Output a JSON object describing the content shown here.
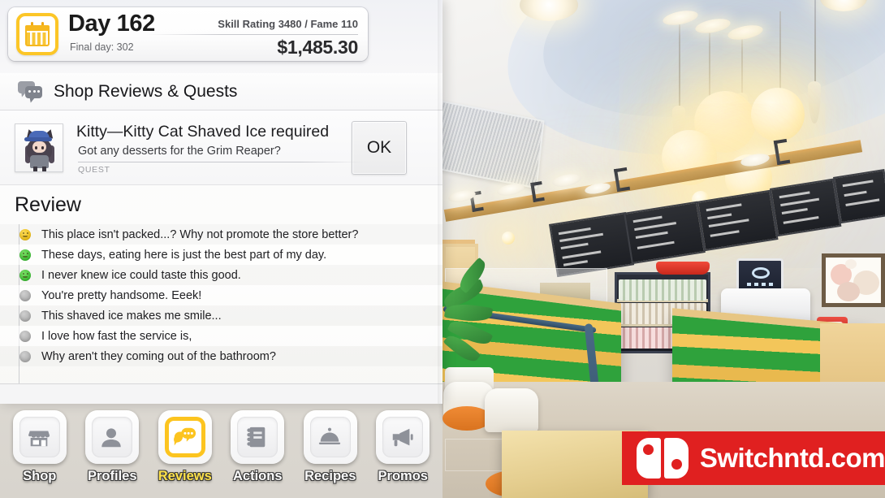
{
  "header": {
    "calendar_icon": "calendar-icon",
    "day_title": "Day 162",
    "final_day": "Final day: 302",
    "skill_line": "Skill Rating 3480 / Fame 110",
    "money": "$1,485.30",
    "accent_color": "#fcc627"
  },
  "section": {
    "icon": "speech-bubbles-icon",
    "title": "Shop Reviews & Quests"
  },
  "quest": {
    "avatar": "chibi-cat-girl-avatar",
    "title": "Kitty—Kitty Cat Shaved Ice required",
    "subtitle": "Got any desserts for the Grim Reaper?",
    "tag": "QUEST",
    "ok_label": "OK"
  },
  "review": {
    "heading": "Review",
    "items": [
      {
        "mood": "yellow",
        "text": "This place isn't packed...? Why not promote the store better?"
      },
      {
        "mood": "green",
        "text": "These days, eating here is just the best part of my day."
      },
      {
        "mood": "green",
        "text": "I never knew ice could taste this good."
      },
      {
        "mood": "gray",
        "text": "You're pretty handsome. Eeek!"
      },
      {
        "mood": "gray",
        "text": "This shaved ice makes me smile..."
      },
      {
        "mood": "gray",
        "text": "I love how fast the service is,"
      },
      {
        "mood": "gray",
        "text": "Why aren't they coming out of the bathroom?"
      }
    ],
    "mood_colors": {
      "yellow": "#efc018",
      "green": "#3cc033",
      "gray": "#aeaeae"
    }
  },
  "nav": {
    "items": [
      {
        "label": "Shop",
        "icon": "storefront-icon",
        "active": false
      },
      {
        "label": "Profiles",
        "icon": "person-icon",
        "active": false
      },
      {
        "label": "Reviews",
        "icon": "speech-bubble-icon",
        "active": true
      },
      {
        "label": "Actions",
        "icon": "notebook-icon",
        "active": false
      },
      {
        "label": "Recipes",
        "icon": "cloche-icon",
        "active": false
      },
      {
        "label": "Promos",
        "icon": "megaphone-icon",
        "active": false
      }
    ],
    "active_label_color": "#ffe24a"
  },
  "watermark": {
    "icon": "nintendo-switch-joycon-icon",
    "text": "Switchntd.com",
    "background_color": "#e02020"
  },
  "background": {
    "scene": "cafe-interior-artwork"
  }
}
